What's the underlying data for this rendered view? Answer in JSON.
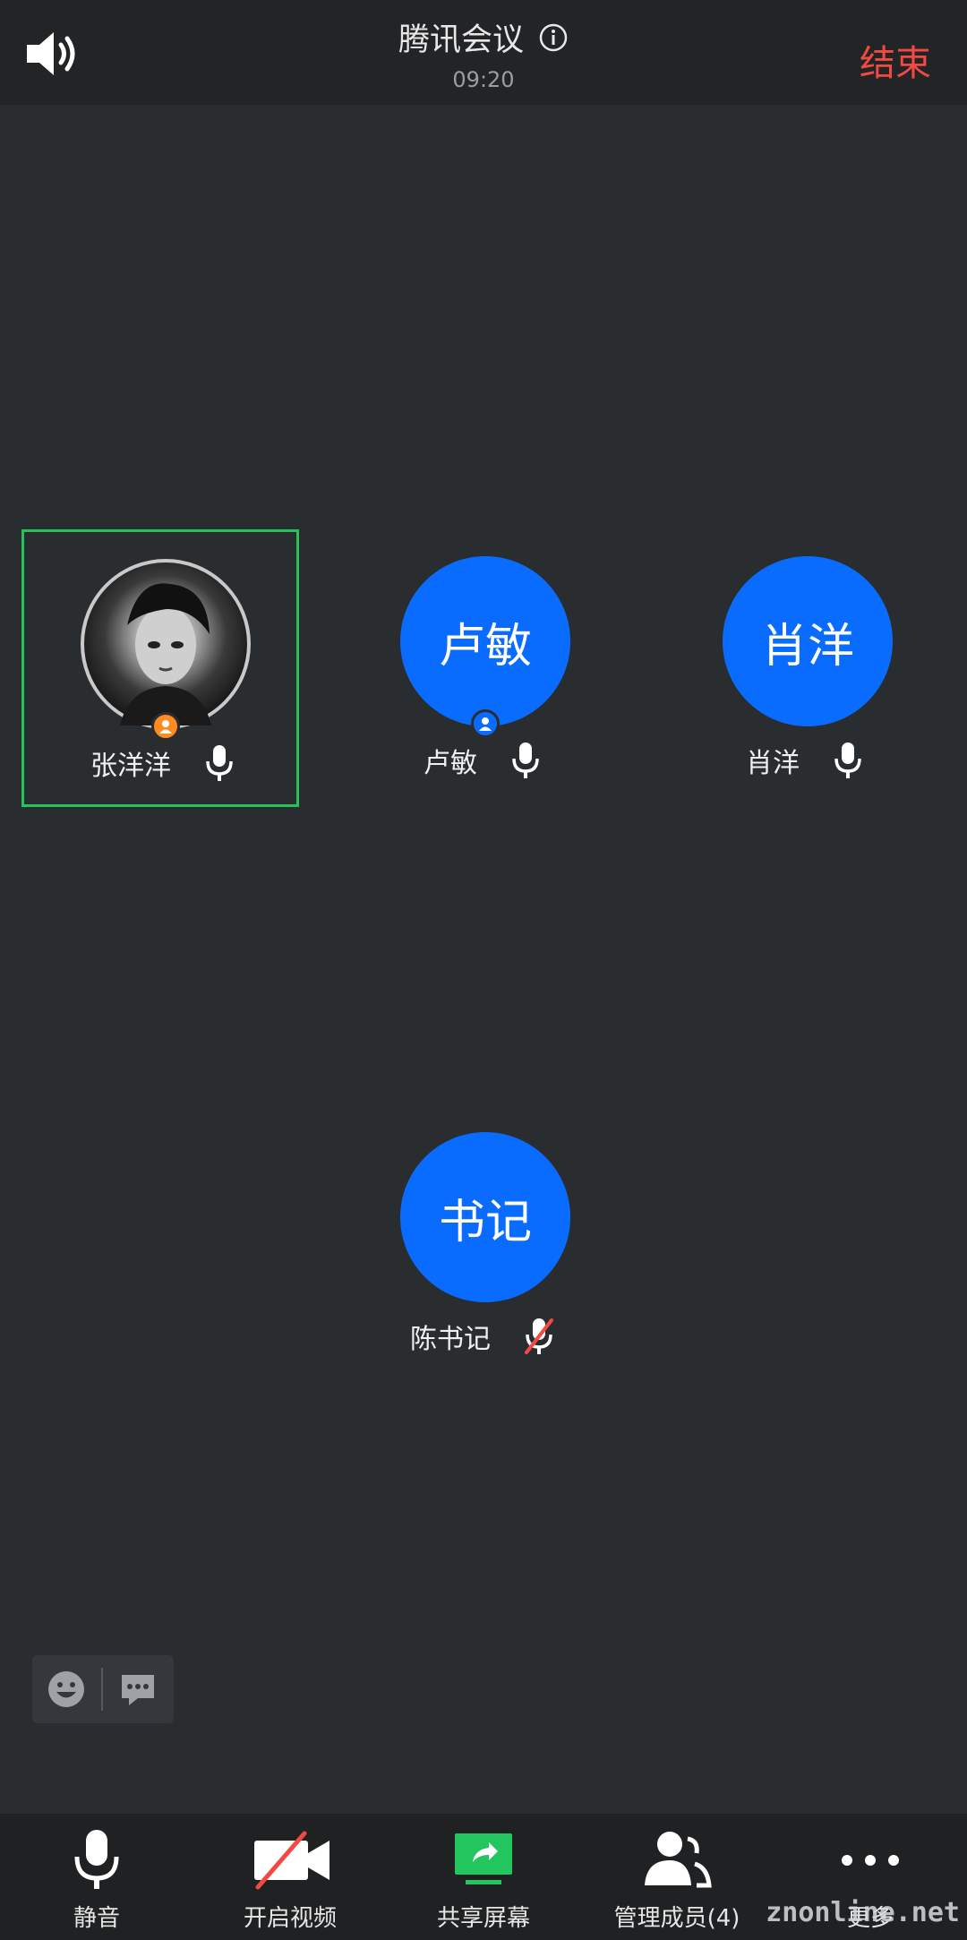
{
  "header": {
    "title": "腾讯会议",
    "time": "09:20",
    "end_label": "结束"
  },
  "participants": [
    {
      "name": "张洋洋",
      "avatar_text": "",
      "avatar_type": "photo",
      "badge": "host",
      "mic": "on",
      "selected": true
    },
    {
      "name": "卢敏",
      "avatar_text": "卢敏",
      "avatar_type": "initials",
      "badge": "cohost",
      "mic": "on",
      "selected": false
    },
    {
      "name": "肖洋",
      "avatar_text": "肖洋",
      "avatar_type": "initials",
      "badge": "",
      "mic": "on",
      "selected": false
    },
    {
      "name": "陈书记",
      "avatar_text": "书记",
      "avatar_type": "initials",
      "badge": "",
      "mic": "muted",
      "selected": false
    }
  ],
  "toolbar": {
    "items": [
      {
        "label": "静音",
        "icon": "microphone-icon"
      },
      {
        "label": "开启视频",
        "icon": "video-off-icon"
      },
      {
        "label": "共享屏幕",
        "icon": "share-screen-icon"
      },
      {
        "label": "管理成员(4)",
        "icon": "members-icon"
      },
      {
        "label": "更多",
        "icon": "more-icon"
      }
    ]
  },
  "watermark": "znonline.net",
  "colors": {
    "accent": "#0a6cff",
    "end": "#f24a43",
    "speaking_border": "#25c45a",
    "host_badge": "#ff8a1f",
    "share_icon": "#22c55e"
  }
}
